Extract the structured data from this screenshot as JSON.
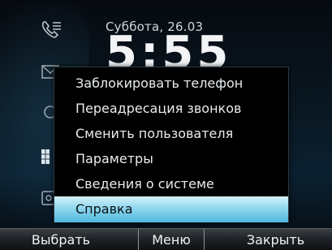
{
  "status": {
    "date": "Суббота, 26.03",
    "time": "5:55"
  },
  "rail": {
    "icons": [
      "call-log-icon",
      "message-icon",
      "contacts-icon",
      "apps-grid-icon",
      "settings-icon"
    ]
  },
  "menu": {
    "items": [
      {
        "label": "Заблокировать телефон"
      },
      {
        "label": "Переадресация звонков"
      },
      {
        "label": "Сменить пользователя"
      },
      {
        "label": "Параметры"
      },
      {
        "label": "Сведения о системе"
      },
      {
        "label": "Справка"
      }
    ],
    "selected_label": "Справка"
  },
  "softkeys": {
    "left": "Выбрать",
    "middle": "Меню",
    "right": "Закрыть"
  },
  "colors": {
    "selection": "#8fd7ee",
    "menu_bg": "#000000"
  }
}
